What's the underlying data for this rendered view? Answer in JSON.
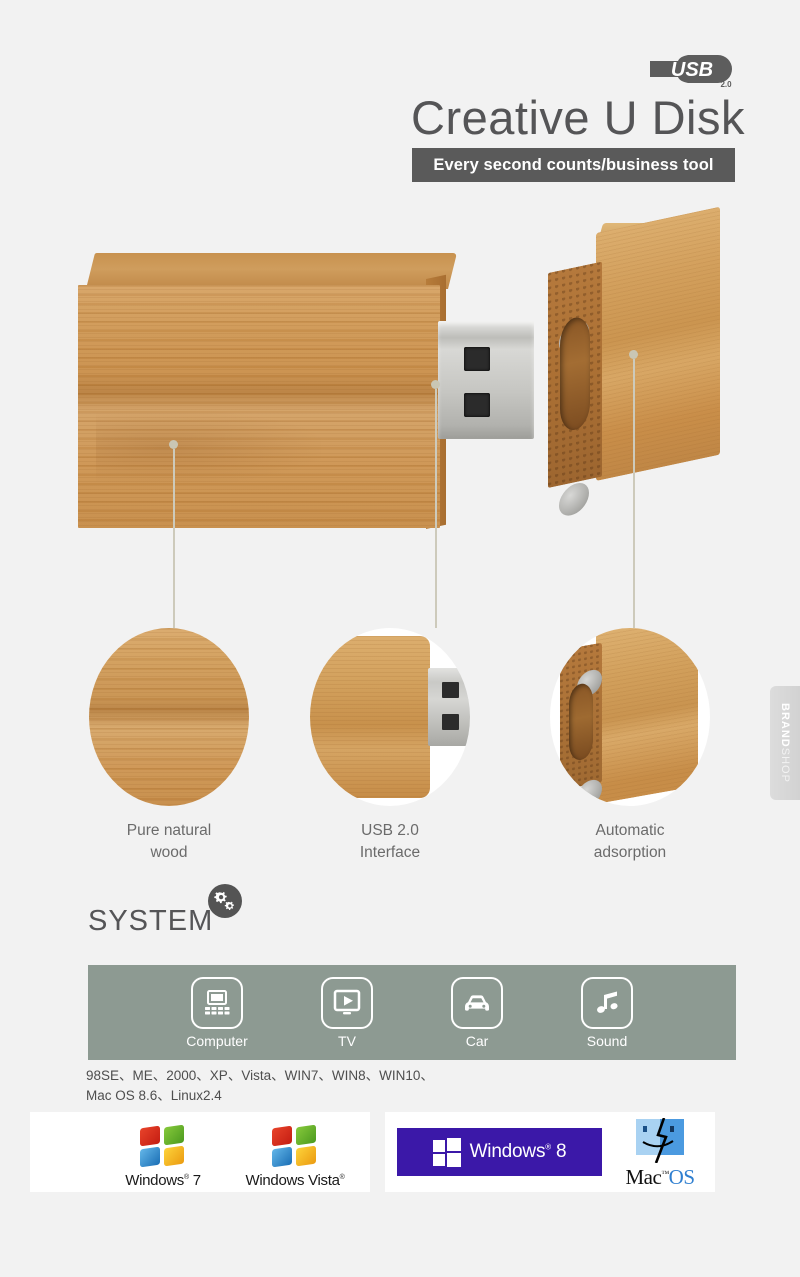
{
  "header": {
    "usb_badge": {
      "text": "USB",
      "version": "2.0",
      "icon": "usb-trident-icon"
    },
    "title": "Creative U Disk",
    "subtitle": "Every second counts/business tool"
  },
  "hero": {
    "alt": "bamboo wooden usb flash drive with magnetic cap"
  },
  "features": [
    {
      "label_line1": "Pure natural",
      "label_line2": "wood",
      "icon": "wood-texture-icon"
    },
    {
      "label_line1": "USB 2.0",
      "label_line2": "Interface",
      "icon": "usb-connector-icon"
    },
    {
      "label_line1": "Automatic",
      "label_line2": "adsorption",
      "icon": "magnet-cap-icon"
    }
  ],
  "system": {
    "heading": "SYSTEM",
    "badge_icon": "gears-icon",
    "devices": [
      {
        "label": "Computer",
        "icon": "laptop-icon"
      },
      {
        "label": "TV",
        "icon": "tv-play-icon"
      },
      {
        "label": "Car",
        "icon": "car-icon"
      },
      {
        "label": "Sound",
        "icon": "music-note-icon"
      }
    ],
    "os_line1": "98SE、ME、2000、XP、Vista、WIN7、WIN8、WIN10、",
    "os_line2": "Mac OS 8.6、Linux2.4",
    "bar_color": "#8d9a92"
  },
  "logos": {
    "windows7": {
      "name": "Windows",
      "version": "7",
      "icon": "windows-flag-icon"
    },
    "vista": {
      "name": "Windows",
      "version": "Vista",
      "icon": "windows-flag-icon"
    },
    "windows8": {
      "name": "Windows",
      "version": "8",
      "icon": "windows-tiles-icon",
      "bg": "#3b18a8"
    },
    "macos": {
      "name": "Mac",
      "suffix": "OS",
      "icon": "finder-face-icon"
    }
  },
  "side_tab": {
    "brand": "BRAND",
    "shop": "SHOP"
  },
  "colors": {
    "background": "#f2f2f2",
    "title_gray": "#555557",
    "bar_gray": "#5a5a5a",
    "system_bar": "#8d9a92",
    "wood": "#cd9450",
    "win8_purple": "#3b18a8",
    "leader_line": "#cdcabb"
  }
}
